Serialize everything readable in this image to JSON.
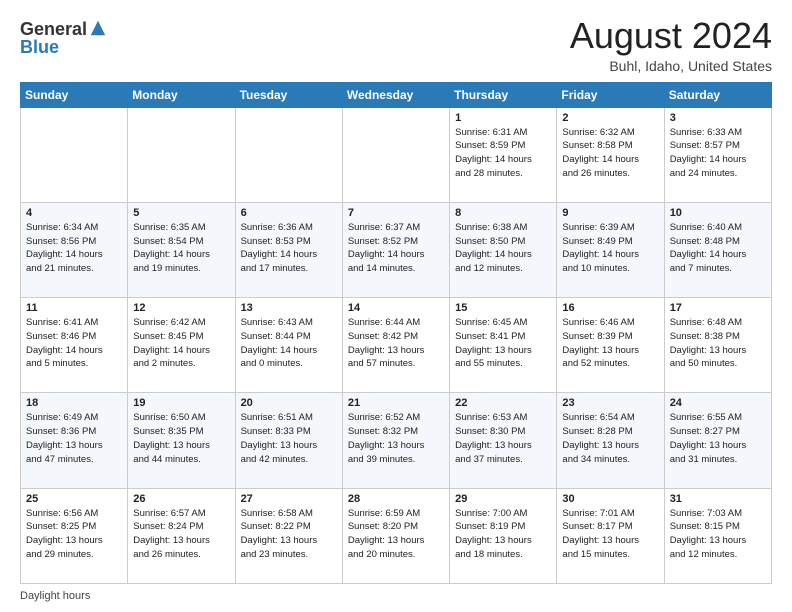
{
  "logo": {
    "general": "General",
    "blue": "Blue"
  },
  "title": "August 2024",
  "subtitle": "Buhl, Idaho, United States",
  "days_of_week": [
    "Sunday",
    "Monday",
    "Tuesday",
    "Wednesday",
    "Thursday",
    "Friday",
    "Saturday"
  ],
  "footer": "Daylight hours",
  "weeks": [
    [
      {
        "day": "",
        "info": ""
      },
      {
        "day": "",
        "info": ""
      },
      {
        "day": "",
        "info": ""
      },
      {
        "day": "",
        "info": ""
      },
      {
        "day": "1",
        "info": "Sunrise: 6:31 AM\nSunset: 8:59 PM\nDaylight: 14 hours\nand 28 minutes."
      },
      {
        "day": "2",
        "info": "Sunrise: 6:32 AM\nSunset: 8:58 PM\nDaylight: 14 hours\nand 26 minutes."
      },
      {
        "day": "3",
        "info": "Sunrise: 6:33 AM\nSunset: 8:57 PM\nDaylight: 14 hours\nand 24 minutes."
      }
    ],
    [
      {
        "day": "4",
        "info": "Sunrise: 6:34 AM\nSunset: 8:56 PM\nDaylight: 14 hours\nand 21 minutes."
      },
      {
        "day": "5",
        "info": "Sunrise: 6:35 AM\nSunset: 8:54 PM\nDaylight: 14 hours\nand 19 minutes."
      },
      {
        "day": "6",
        "info": "Sunrise: 6:36 AM\nSunset: 8:53 PM\nDaylight: 14 hours\nand 17 minutes."
      },
      {
        "day": "7",
        "info": "Sunrise: 6:37 AM\nSunset: 8:52 PM\nDaylight: 14 hours\nand 14 minutes."
      },
      {
        "day": "8",
        "info": "Sunrise: 6:38 AM\nSunset: 8:50 PM\nDaylight: 14 hours\nand 12 minutes."
      },
      {
        "day": "9",
        "info": "Sunrise: 6:39 AM\nSunset: 8:49 PM\nDaylight: 14 hours\nand 10 minutes."
      },
      {
        "day": "10",
        "info": "Sunrise: 6:40 AM\nSunset: 8:48 PM\nDaylight: 14 hours\nand 7 minutes."
      }
    ],
    [
      {
        "day": "11",
        "info": "Sunrise: 6:41 AM\nSunset: 8:46 PM\nDaylight: 14 hours\nand 5 minutes."
      },
      {
        "day": "12",
        "info": "Sunrise: 6:42 AM\nSunset: 8:45 PM\nDaylight: 14 hours\nand 2 minutes."
      },
      {
        "day": "13",
        "info": "Sunrise: 6:43 AM\nSunset: 8:44 PM\nDaylight: 14 hours\nand 0 minutes."
      },
      {
        "day": "14",
        "info": "Sunrise: 6:44 AM\nSunset: 8:42 PM\nDaylight: 13 hours\nand 57 minutes."
      },
      {
        "day": "15",
        "info": "Sunrise: 6:45 AM\nSunset: 8:41 PM\nDaylight: 13 hours\nand 55 minutes."
      },
      {
        "day": "16",
        "info": "Sunrise: 6:46 AM\nSunset: 8:39 PM\nDaylight: 13 hours\nand 52 minutes."
      },
      {
        "day": "17",
        "info": "Sunrise: 6:48 AM\nSunset: 8:38 PM\nDaylight: 13 hours\nand 50 minutes."
      }
    ],
    [
      {
        "day": "18",
        "info": "Sunrise: 6:49 AM\nSunset: 8:36 PM\nDaylight: 13 hours\nand 47 minutes."
      },
      {
        "day": "19",
        "info": "Sunrise: 6:50 AM\nSunset: 8:35 PM\nDaylight: 13 hours\nand 44 minutes."
      },
      {
        "day": "20",
        "info": "Sunrise: 6:51 AM\nSunset: 8:33 PM\nDaylight: 13 hours\nand 42 minutes."
      },
      {
        "day": "21",
        "info": "Sunrise: 6:52 AM\nSunset: 8:32 PM\nDaylight: 13 hours\nand 39 minutes."
      },
      {
        "day": "22",
        "info": "Sunrise: 6:53 AM\nSunset: 8:30 PM\nDaylight: 13 hours\nand 37 minutes."
      },
      {
        "day": "23",
        "info": "Sunrise: 6:54 AM\nSunset: 8:28 PM\nDaylight: 13 hours\nand 34 minutes."
      },
      {
        "day": "24",
        "info": "Sunrise: 6:55 AM\nSunset: 8:27 PM\nDaylight: 13 hours\nand 31 minutes."
      }
    ],
    [
      {
        "day": "25",
        "info": "Sunrise: 6:56 AM\nSunset: 8:25 PM\nDaylight: 13 hours\nand 29 minutes."
      },
      {
        "day": "26",
        "info": "Sunrise: 6:57 AM\nSunset: 8:24 PM\nDaylight: 13 hours\nand 26 minutes."
      },
      {
        "day": "27",
        "info": "Sunrise: 6:58 AM\nSunset: 8:22 PM\nDaylight: 13 hours\nand 23 minutes."
      },
      {
        "day": "28",
        "info": "Sunrise: 6:59 AM\nSunset: 8:20 PM\nDaylight: 13 hours\nand 20 minutes."
      },
      {
        "day": "29",
        "info": "Sunrise: 7:00 AM\nSunset: 8:19 PM\nDaylight: 13 hours\nand 18 minutes."
      },
      {
        "day": "30",
        "info": "Sunrise: 7:01 AM\nSunset: 8:17 PM\nDaylight: 13 hours\nand 15 minutes."
      },
      {
        "day": "31",
        "info": "Sunrise: 7:03 AM\nSunset: 8:15 PM\nDaylight: 13 hours\nand 12 minutes."
      }
    ]
  ]
}
